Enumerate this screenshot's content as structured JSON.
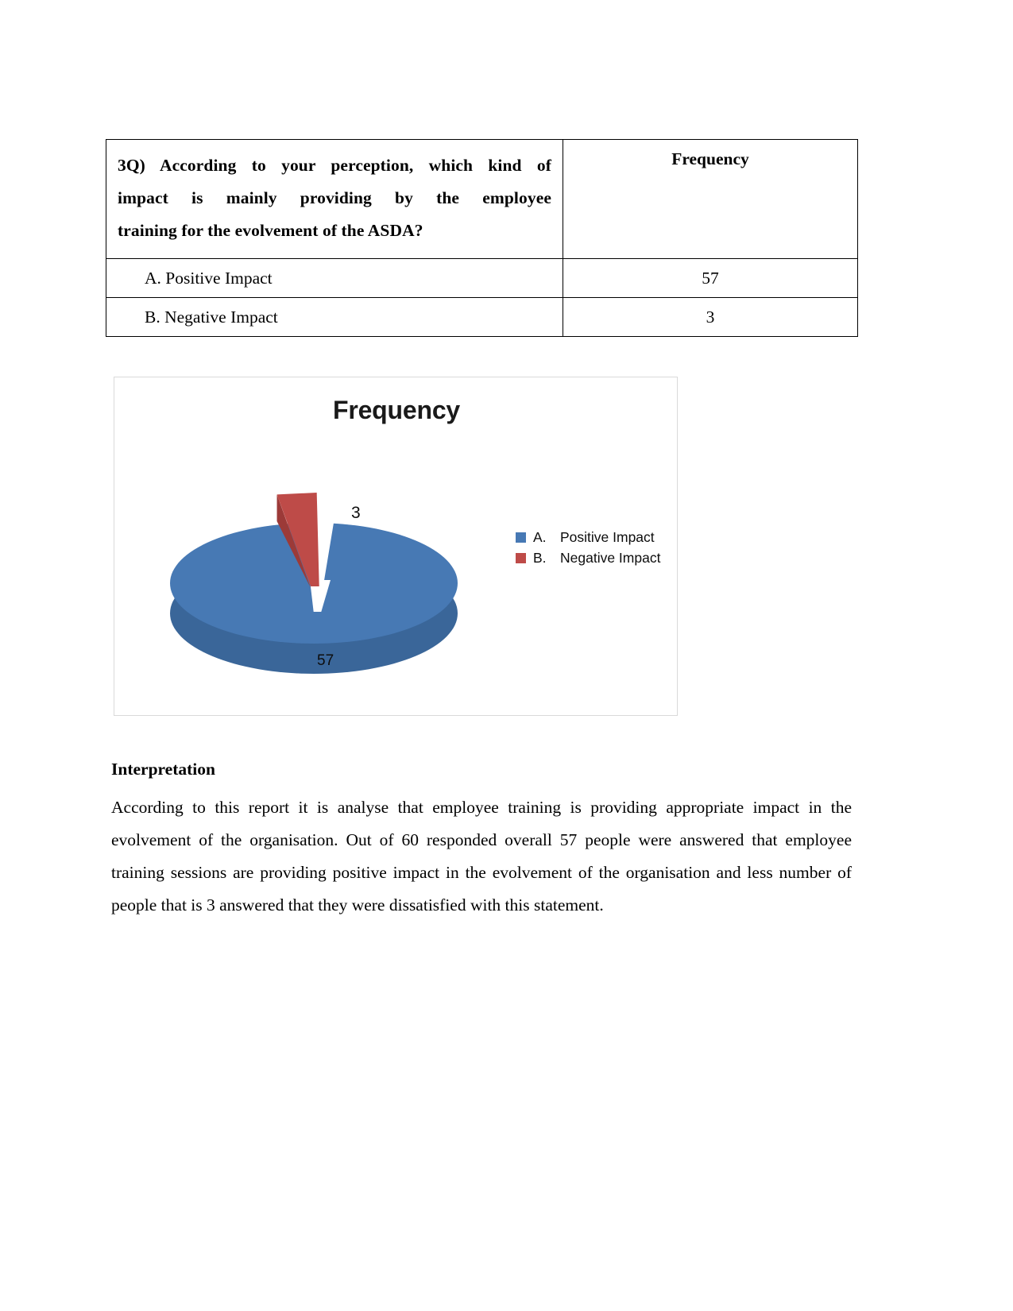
{
  "table": {
    "question": "3Q) According to your perception, which kind of impact is mainly providing by the employee training for the evolvement of the ASDA?",
    "question_line1": "3Q) According to your perception, which kind of",
    "question_line2": "impact is mainly providing by the employee",
    "question_line3": "training for the evolvement of the ASDA?",
    "frequency_header": "Frequency",
    "rows": [
      {
        "label": "A.  Positive Impact",
        "value": "57"
      },
      {
        "label": "B.  Negative Impact",
        "value": "3"
      }
    ]
  },
  "chart": {
    "title": "Frequency",
    "label_negative": "3",
    "label_positive": "57",
    "legend": [
      {
        "key": "A.",
        "text": "Positive Impact",
        "color": "#4779b4"
      },
      {
        "key": "B.",
        "text": "Negative Impact",
        "color": "#be4b48"
      }
    ]
  },
  "chart_data": {
    "type": "pie",
    "title": "Frequency",
    "categories": [
      "A.    Positive Impact",
      "B.    Negative Impact"
    ],
    "values": [
      57,
      3
    ],
    "labels": [
      "57",
      "3"
    ],
    "colors": [
      "#4779b4",
      "#be4b48"
    ],
    "total": 60,
    "percentages": [
      95.0,
      5.0
    ],
    "legend_position": "right",
    "three_d": true,
    "exploded_slices": [
      "B.    Negative Impact"
    ],
    "grid": false,
    "xlabel": "",
    "ylabel": ""
  },
  "interpretation": {
    "heading": "Interpretation",
    "body": "According to this report it is analyse that employee training is providing appropriate impact in the evolvement of the organisation. Out of 60 responded overall 57 people were answered that employee training sessions are providing positive impact in the evolvement of the organisation and less number of people that is 3 answered that they were dissatisfied with this statement."
  }
}
